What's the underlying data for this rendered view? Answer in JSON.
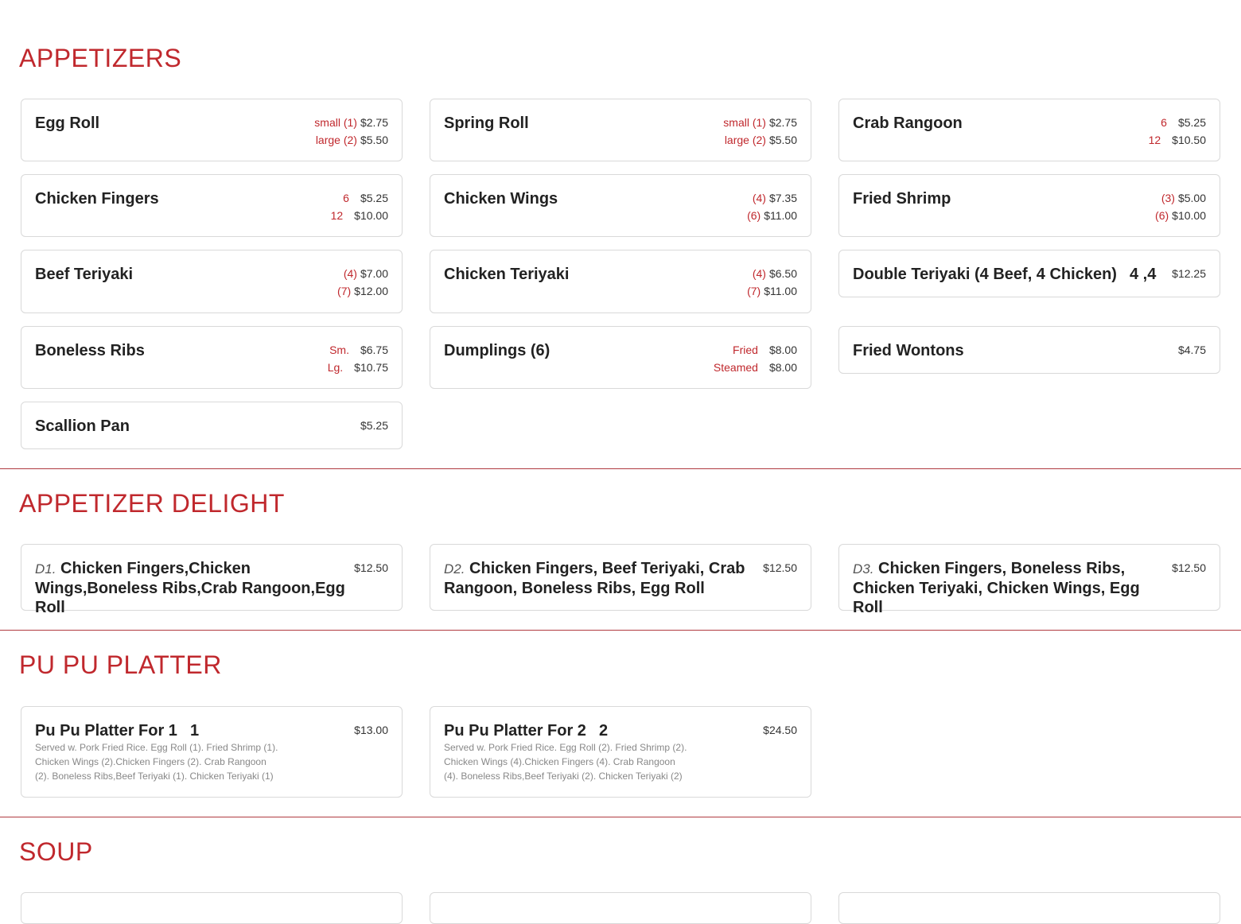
{
  "sections": {
    "appetizers": {
      "title": "APPETIZERS",
      "items": [
        {
          "name": "Egg Roll",
          "prices": [
            {
              "label": "small (1)",
              "value": "$2.75"
            },
            {
              "label": "large (2)",
              "value": "$5.50"
            }
          ]
        },
        {
          "name": "Spring Roll",
          "prices": [
            {
              "label": "small (1)",
              "value": "$2.75"
            },
            {
              "label": "large (2)",
              "value": "$5.50"
            }
          ]
        },
        {
          "name": "Crab Rangoon",
          "prices": [
            {
              "label": "6",
              "value": "$5.25"
            },
            {
              "label": "12",
              "value": "$10.50"
            }
          ]
        },
        {
          "name": "Chicken Fingers",
          "prices": [
            {
              "label": "6",
              "value": "$5.25"
            },
            {
              "label": "12",
              "value": "$10.00"
            }
          ]
        },
        {
          "name": "Chicken Wings",
          "prices": [
            {
              "label": "(4)",
              "value": "$7.35"
            },
            {
              "label": "(6)",
              "value": "$11.00"
            }
          ]
        },
        {
          "name": "Fried Shrimp",
          "prices": [
            {
              "label": "(3)",
              "value": "$5.00"
            },
            {
              "label": "(6)",
              "value": "$10.00"
            }
          ]
        },
        {
          "name": "Beef Teriyaki",
          "prices": [
            {
              "label": "(4)",
              "value": "$7.00"
            },
            {
              "label": "(7)",
              "value": "$12.00"
            }
          ]
        },
        {
          "name": "Chicken Teriyaki",
          "prices": [
            {
              "label": "(4)",
              "value": "$6.50"
            },
            {
              "label": "(7)",
              "value": "$11.00"
            }
          ]
        },
        {
          "name": "Double Teriyaki (4 Beef, 4 Chicken)",
          "extra": "4 ,4",
          "prices": [
            {
              "label": "",
              "value": "$12.25"
            }
          ]
        },
        {
          "name": "Boneless Ribs",
          "prices": [
            {
              "label": "Sm.",
              "value": "$6.75"
            },
            {
              "label": "Lg.",
              "value": "$10.75"
            }
          ]
        },
        {
          "name": "Dumplings (6)",
          "prices": [
            {
              "label": "Fried",
              "value": "$8.00"
            },
            {
              "label": "Steamed",
              "value": "$8.00"
            }
          ]
        },
        {
          "name": "Fried Wontons",
          "prices": [
            {
              "label": "",
              "value": "$4.75"
            }
          ]
        },
        {
          "name": "Scallion Pan",
          "prices": [
            {
              "label": "",
              "value": "$5.25"
            }
          ]
        }
      ]
    },
    "delight": {
      "title": "APPETIZER DELIGHT",
      "items": [
        {
          "code": "D1.",
          "name": "Chicken Fingers,Chicken Wings,Boneless Ribs,Crab Rangoon,Egg Roll",
          "price": "$12.50"
        },
        {
          "code": "D2.",
          "name": "Chicken Fingers, Beef Teriyaki, Crab Rangoon, Boneless Ribs, Egg Roll",
          "price": "$12.50"
        },
        {
          "code": "D3.",
          "name": "Chicken Fingers, Boneless Ribs, Chicken Teriyaki, Chicken Wings, Egg Roll",
          "price": "$12.50"
        }
      ]
    },
    "pupu": {
      "title": "PU PU PLATTER",
      "items": [
        {
          "name": "Pu Pu Platter For 1",
          "extra": "1",
          "price": "$13.00",
          "desc": "Served w. Pork Fried Rice. Egg Roll (1). Fried Shrimp (1). Chicken Wings (2).Chicken Fingers (2). Crab Rangoon (2). Boneless Ribs,Beef Teriyaki (1). Chicken Teriyaki (1)"
        },
        {
          "name": "Pu Pu Platter For 2",
          "extra": "2",
          "price": "$24.50",
          "desc": "Served w. Pork Fried Rice. Egg Roll (2). Fried Shrimp (2). Chicken Wings (4).Chicken Fingers (4). Crab Rangoon (4). Boneless Ribs,Beef Teriyaki (2). Chicken Teriyaki (2)"
        }
      ]
    },
    "soup": {
      "title": "SOUP"
    }
  },
  "colors": {
    "accent": "#c0282d",
    "border": "#d9d9d9",
    "divider": "#b03a40"
  }
}
